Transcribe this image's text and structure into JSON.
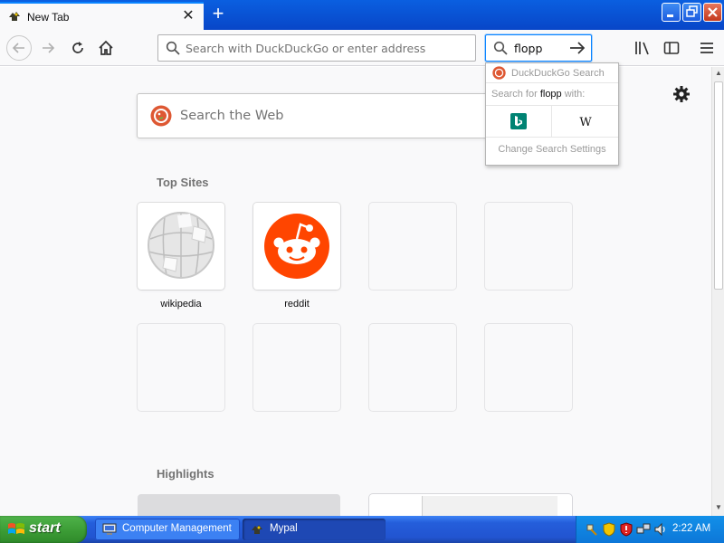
{
  "browser": {
    "tab": {
      "title": "New Tab",
      "favicon": "firefox-mypal-favicon"
    },
    "window_controls": [
      "minimize-icon",
      "maximize-icon",
      "close-icon"
    ],
    "url_placeholder": "Search with DuckDuckGo or enter address",
    "search_value": "flopp"
  },
  "search_popup": {
    "header": "DuckDuckGo Search",
    "for_prefix": "Search for ",
    "for_term": "flopp",
    "for_suffix": " with:",
    "engines": [
      "Bing",
      "Wikipedia"
    ],
    "settings_label": "Change Search Settings"
  },
  "newtab": {
    "search_placeholder": "Search the Web",
    "top_sites_title": "Top Sites",
    "top_sites": [
      {
        "label": "wikipedia"
      },
      {
        "label": "reddit"
      }
    ],
    "highlights_title": "Highlights"
  },
  "taskbar": {
    "start_label": "start",
    "tasks": [
      {
        "label": "Computer Management",
        "icon": "computer-icon"
      },
      {
        "label": "Mypal",
        "icon": "mypal-icon"
      }
    ],
    "clock": "2:22 AM"
  },
  "colors": {
    "accent": "#0a84ff",
    "titlebar": "#0846c8",
    "reddit": "#ff4500",
    "ddg": "#de5833",
    "start": "#3a9a34"
  }
}
